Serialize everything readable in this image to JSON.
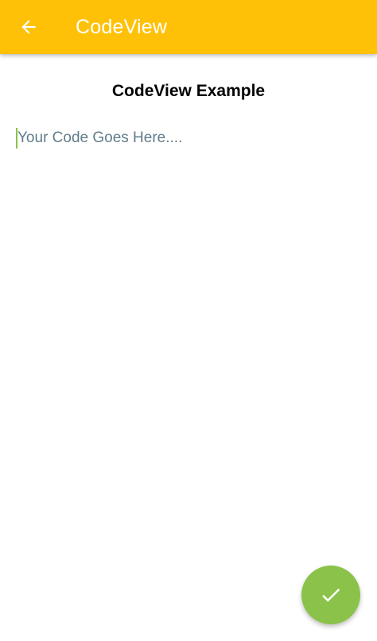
{
  "app_bar": {
    "title": "CodeView",
    "background": "#FFC107",
    "back_icon": "arrow-left-icon"
  },
  "main": {
    "heading": "CodeView Example",
    "editor": {
      "value": "",
      "placeholder": "Your Code Goes Here....",
      "cursor_color": "#8BC34A"
    }
  },
  "fab": {
    "icon": "check-icon",
    "background": "#8BC34A"
  }
}
